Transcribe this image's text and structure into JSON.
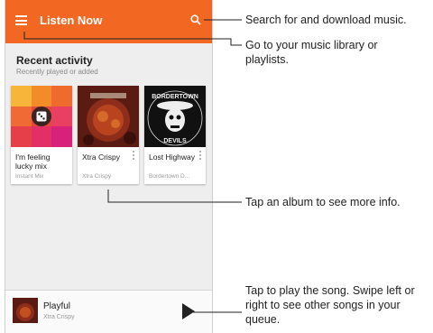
{
  "appbar": {
    "title": "Listen Now",
    "color": "#f26722"
  },
  "recent": {
    "title": "Recent activity",
    "subtitle": "Recently played or added"
  },
  "cards": [
    {
      "title": "I'm feeling lucky mix",
      "subtitle": "Instant Mix"
    },
    {
      "title": "Xtra Crispy",
      "subtitle": "Xtra Crispy"
    },
    {
      "title": "Lost Highway",
      "subtitle": "Bordertown D...",
      "art_text_top": "BORDERTOWN",
      "art_text_bottom": "DEVILS"
    }
  ],
  "player": {
    "title": "Playful",
    "artist": "Xtra Crispy"
  },
  "callouts": {
    "search": "Search for and download music.",
    "menu": "Go to your music library or playlists.",
    "album": "Tap an album to see more info.",
    "play": "Tap to play the song. Swipe left or right to see other songs in your queue."
  },
  "icons": [
    "menu-icon",
    "search-icon",
    "dice-icon",
    "more-vert-icon",
    "play-icon"
  ]
}
